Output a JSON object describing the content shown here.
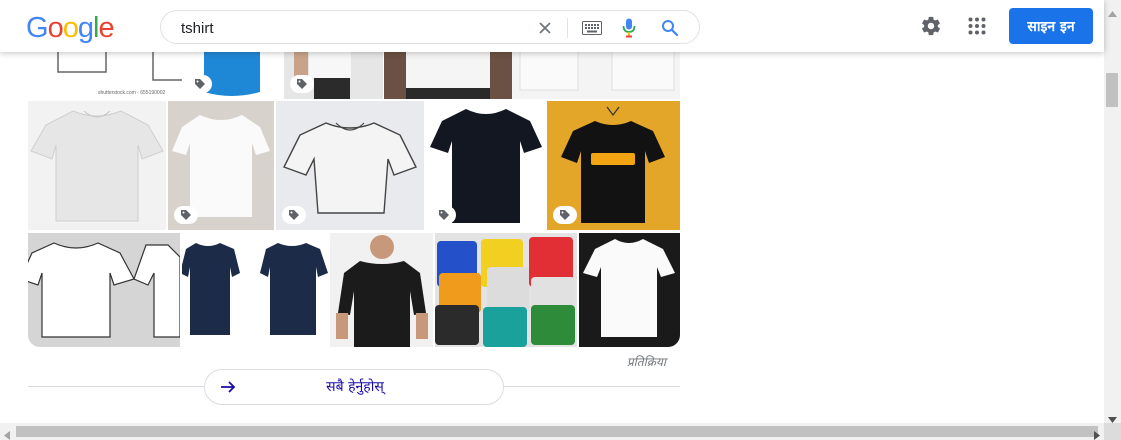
{
  "header": {
    "logo_letters": [
      "G",
      "o",
      "o",
      "g",
      "l",
      "e"
    ],
    "logo_colors": [
      "#4285f4",
      "#ea4335",
      "#fbbc05",
      "#4285f4",
      "#34a853",
      "#ea4335"
    ],
    "search_value": "tshirt",
    "signin_label": "साइन इन"
  },
  "icons": {
    "clear": "close-icon",
    "keyboard": "keyboard-icon",
    "voice": "mic-icon",
    "search": "search-icon",
    "settings": "gear-icon",
    "apps": "apps-grid-icon",
    "tag": "shopping-tag-icon",
    "see_all": "arrow-right-icon"
  },
  "images": {
    "row1_alt_text": "shutterstock.com · 655190002"
  },
  "feedback_label": "प्रतिक्रिया",
  "see_all_label": "सबै हेर्नुहोस्",
  "colors": {
    "accent": "#1a73e8",
    "link": "#1a0dab"
  }
}
